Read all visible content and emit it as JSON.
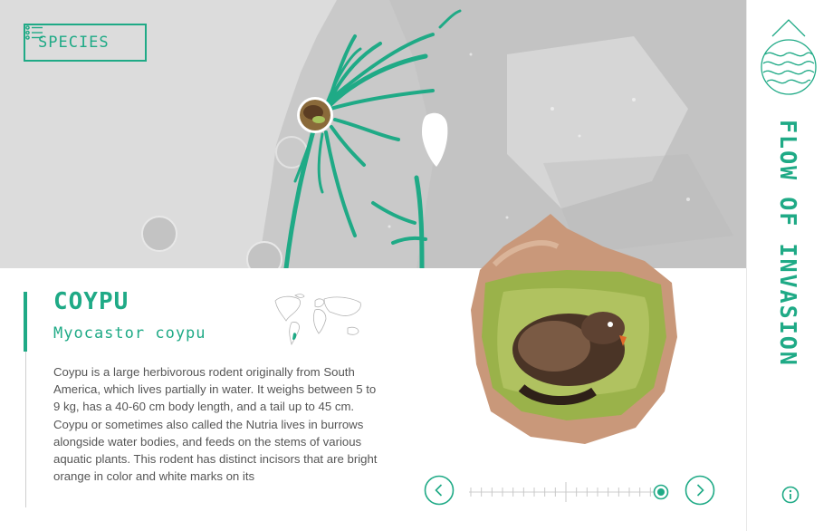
{
  "header": {
    "species_button_label": "SPECIES"
  },
  "app": {
    "title": "FLOW OF INVASION"
  },
  "species": {
    "name": "COYPU",
    "latin_name": "Myocastor coypu",
    "description": "Coypu is a large herbivorous rodent originally from South America, which lives partially in water. It weighs between 5 to 9 kg, has a 40-60 cm body length, and a tail up to 45 cm. Coypu or sometimes also called the Nutria lives in burrows alongside water bodies, and feeds on the stems of various aquatic plants. This rodent has distinct incisors that are bright orange in color and white marks on its"
  },
  "carousel": {
    "total_steps": 19,
    "active_index": 18
  },
  "icons": {
    "menu": "list-icon",
    "logo": "globe-waves-icon",
    "info": "info-icon",
    "prev": "chevron-left-icon",
    "next": "chevron-right-icon"
  },
  "colors": {
    "accent": "#1faa86",
    "map_background": "#d4d4d4"
  }
}
